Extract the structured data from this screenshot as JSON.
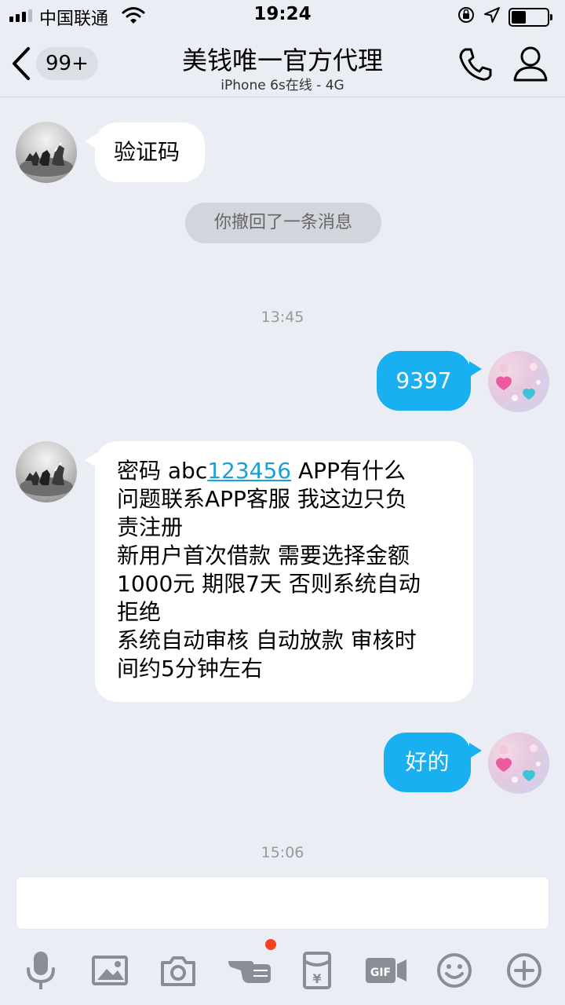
{
  "status_bar": {
    "carrier": "中国联通",
    "time": "19:24"
  },
  "nav": {
    "unread_badge": "99+",
    "title": "美钱唯一官方代理",
    "subtitle": "iPhone 6s在线 - 4G"
  },
  "messages": {
    "m1_text": "验证码",
    "recall_notice": "你撤回了一条消息",
    "time_1": "13:45",
    "m2_text": "9397",
    "m3_prefix": "密码  abc",
    "m3_link": "123456",
    "m3_rest": "   APP有什么\n问题联系APP客服  我这边只负\n责注册\n新用户首次借款 需要选择金额\n1000元  期限7天 否则系统自动\n拒绝\n系统自动审核 自动放款 审核时\n间约5分钟左右",
    "m4_text": "好的",
    "time_2": "15:06"
  },
  "input": {
    "value": ""
  },
  "toolbar": {
    "items": [
      "microphone-icon",
      "image-icon",
      "camera-icon",
      "poke-hand-icon",
      "red-packet-icon",
      "gif-icon",
      "emoji-icon",
      "plus-icon"
    ]
  },
  "colors": {
    "background": "#ebedf5",
    "outgoing_bubble": "#18b0f0",
    "incoming_bubble": "#ffffff",
    "link": "#1aa0d8",
    "notification_dot": "#f5411f"
  }
}
